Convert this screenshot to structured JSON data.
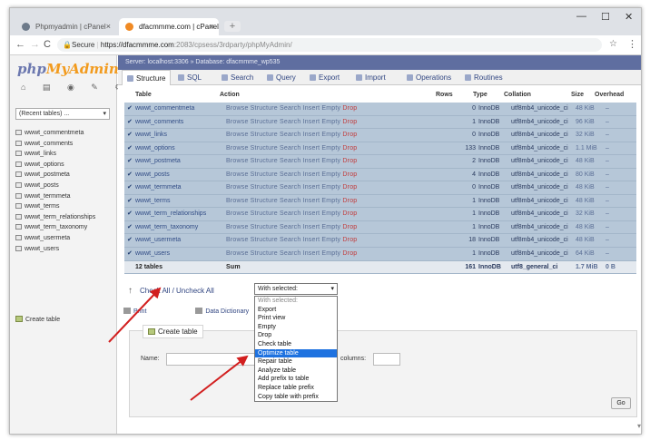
{
  "browser": {
    "tabs": [
      {
        "label": "Phpmyadmin | cPanel",
        "close": "×"
      },
      {
        "label": "dfacmmme.com | cPanel",
        "close": "×"
      }
    ],
    "new_tab": "+",
    "window_controls": {
      "minimize": "—",
      "maximize": "☐",
      "close": "✕"
    },
    "nav": {
      "back": "←",
      "forward": "→",
      "reload": "C"
    },
    "address": {
      "secure_label": "Secure",
      "host": "https://dfacmmme.com",
      "path": ":2083/cpsess/3rdparty/phpMyAdmin/"
    },
    "star": "☆",
    "menu": "⋮"
  },
  "left_panel": {
    "logo_a": "php",
    "logo_b": "MyAdmin",
    "icons": "⌂ ▤ ◉ ✎ ⚙",
    "recent_label": "(Recent tables) ...",
    "tables": [
      "wwwt_commentmeta",
      "wwwt_comments",
      "wwwt_links",
      "wwwt_options",
      "wwwt_postmeta",
      "wwwt_posts",
      "wwwt_termmeta",
      "wwwt_terms",
      "wwwt_term_relationships",
      "wwwt_term_taxonomy",
      "wwwt_usermeta",
      "wwwt_users"
    ],
    "create_table": "Create table"
  },
  "main": {
    "breadcrumb": "Server: localhost:3306 » Database: dfacmmme_wp535",
    "tabs": [
      "Structure",
      "SQL",
      "Search",
      "Query",
      "Export",
      "Import",
      "Operations",
      "Routines"
    ],
    "headers": {
      "table": "Table",
      "action": "Action",
      "rows": "Rows",
      "type": "Type",
      "collation": "Collation",
      "size": "Size",
      "overhead": "Overhead"
    },
    "row_actions": "Browse  Structure  Search  Insert  Empty",
    "drop_label": "Drop",
    "rows": [
      {
        "name": "wwwt_commentmeta",
        "rows": "0",
        "type": "InnoDB",
        "collation": "utf8mb4_unicode_ci",
        "size": "48 KiB",
        "overhead": "–"
      },
      {
        "name": "wwwt_comments",
        "rows": "1",
        "type": "InnoDB",
        "collation": "utf8mb4_unicode_ci",
        "size": "96 KiB",
        "overhead": "–"
      },
      {
        "name": "wwwt_links",
        "rows": "0",
        "type": "InnoDB",
        "collation": "utf8mb4_unicode_ci",
        "size": "32 KiB",
        "overhead": "–"
      },
      {
        "name": "wwwt_options",
        "rows": "133",
        "type": "InnoDB",
        "collation": "utf8mb4_unicode_ci",
        "size": "1.1 MiB",
        "overhead": "–"
      },
      {
        "name": "wwwt_postmeta",
        "rows": "2",
        "type": "InnoDB",
        "collation": "utf8mb4_unicode_ci",
        "size": "48 KiB",
        "overhead": "–"
      },
      {
        "name": "wwwt_posts",
        "rows": "4",
        "type": "InnoDB",
        "collation": "utf8mb4_unicode_ci",
        "size": "80 KiB",
        "overhead": "–"
      },
      {
        "name": "wwwt_termmeta",
        "rows": "0",
        "type": "InnoDB",
        "collation": "utf8mb4_unicode_ci",
        "size": "48 KiB",
        "overhead": "–"
      },
      {
        "name": "wwwt_terms",
        "rows": "1",
        "type": "InnoDB",
        "collation": "utf8mb4_unicode_ci",
        "size": "48 KiB",
        "overhead": "–"
      },
      {
        "name": "wwwt_term_relationships",
        "rows": "1",
        "type": "InnoDB",
        "collation": "utf8mb4_unicode_ci",
        "size": "32 KiB",
        "overhead": "–"
      },
      {
        "name": "wwwt_term_taxonomy",
        "rows": "1",
        "type": "InnoDB",
        "collation": "utf8mb4_unicode_ci",
        "size": "48 KiB",
        "overhead": "–"
      },
      {
        "name": "wwwt_usermeta",
        "rows": "18",
        "type": "InnoDB",
        "collation": "utf8mb4_unicode_ci",
        "size": "48 KiB",
        "overhead": "–"
      },
      {
        "name": "wwwt_users",
        "rows": "1",
        "type": "InnoDB",
        "collation": "utf8mb4_unicode_ci",
        "size": "64 KiB",
        "overhead": "–"
      }
    ],
    "summary": {
      "name": "12 tables",
      "action": "Sum",
      "rows": "161",
      "type": "InnoDB",
      "collation": "utf8_general_ci",
      "size": "1.7 MiB",
      "overhead": "0 B"
    },
    "check_all": "Check All / Uncheck All",
    "with_selected": "With selected:",
    "dropdown_options": [
      "With selected:",
      "Export",
      "Print view",
      "Empty",
      "Drop",
      "Check table",
      "Optimize table",
      "Repair table",
      "Analyze table",
      "Add prefix to table",
      "Replace table prefix",
      "Copy table with prefix"
    ],
    "highlight_index": 6,
    "print": "Print",
    "data_dictionary": "Data Dictionary",
    "create_legend": "Create table",
    "name_label": "Name:",
    "columns_label": "columns:",
    "go": "Go"
  },
  "colors": {
    "accent": "#1e72e0",
    "row": "#b6c7d8",
    "annotation": "#d21f1f",
    "breadcrumb": "#5f6ea0"
  }
}
